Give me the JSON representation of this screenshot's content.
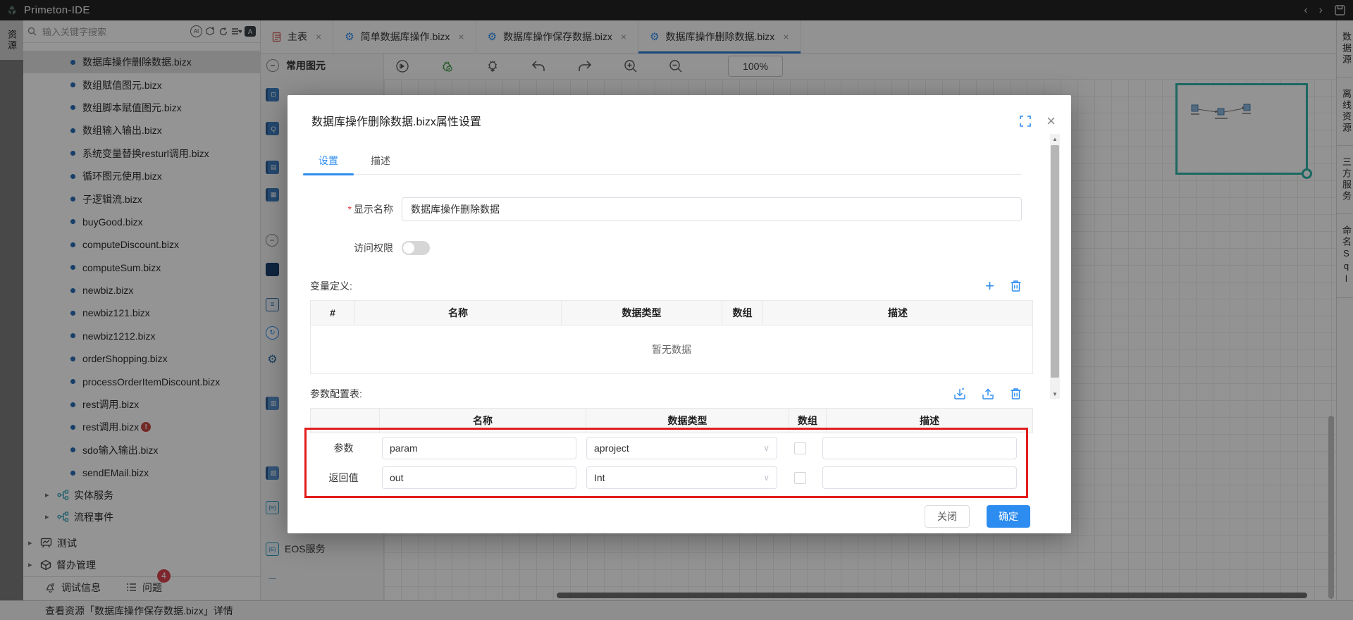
{
  "titlebar": {
    "title": "Primeton-IDE",
    "back": "‹",
    "forward": "›"
  },
  "left_rail": {
    "tab": "资源"
  },
  "sidebar": {
    "search": {
      "placeholder": "输入关键字搜索"
    },
    "files": [
      {
        "label": "数据库操作删除数据.bizx",
        "selected": true
      },
      {
        "label": "数组赋值图元.bizx"
      },
      {
        "label": "数组脚本赋值图元.bizx"
      },
      {
        "label": "数组输入输出.bizx"
      },
      {
        "label": "系统变量替换resturl调用.bizx"
      },
      {
        "label": "循环图元使用.bizx"
      },
      {
        "label": "子逻辑流.bizx"
      },
      {
        "label": "buyGood.bizx"
      },
      {
        "label": "computeDiscount.bizx"
      },
      {
        "label": "computeSum.bizx"
      },
      {
        "label": "newbiz.bizx"
      },
      {
        "label": "newbiz121.bizx"
      },
      {
        "label": "newbiz1212.bizx"
      },
      {
        "label": "orderShopping.bizx"
      },
      {
        "label": "processOrderItemDiscount.bizx"
      },
      {
        "label": "rest调用.bizx"
      },
      {
        "label": "rest调用.bizx",
        "badge": "!"
      },
      {
        "label": "sdo输入输出.bizx"
      },
      {
        "label": "sendEMail.bizx"
      }
    ],
    "services": [
      {
        "label": "实体服务"
      },
      {
        "label": "流程事件"
      }
    ],
    "sections": [
      {
        "label": "测试",
        "icon": "chart"
      },
      {
        "label": "督办管理",
        "icon": "cube"
      }
    ],
    "debug_bar": {
      "debug": "调试信息",
      "problems": "问题",
      "problems_badge": "4"
    }
  },
  "editor": {
    "tabs": [
      {
        "label": "主表",
        "icon": "doc"
      },
      {
        "label": "简单数据库操作.bizx",
        "icon": "gear"
      },
      {
        "label": "数据库操作保存数据.bizx",
        "icon": "gear"
      },
      {
        "label": "数据库操作删除数据.bizx",
        "icon": "gear",
        "active": true
      }
    ],
    "toolbar": {
      "zoom": "100%"
    }
  },
  "palette": {
    "group_title": "常用图元",
    "eos_label": "EOS服务"
  },
  "right_rail": {
    "items": [
      "数据源",
      "离线资源",
      "三方服务",
      "命名Sql"
    ]
  },
  "modal": {
    "title": "数据库操作删除数据.bizx属性设置",
    "tabs": [
      {
        "label": "设置",
        "active": true
      },
      {
        "label": "描述"
      }
    ],
    "fields": {
      "display_name_label": "显示名称",
      "display_name_value": "数据库操作删除数据",
      "access_label": "访问权限",
      "access_on": false
    },
    "variables": {
      "section_label": "变量定义:",
      "headers": [
        "#",
        "名称",
        "数据类型",
        "数组",
        "描述"
      ],
      "empty_text": "暂无数据"
    },
    "params": {
      "section_label": "参数配置表:",
      "headers": [
        "",
        "名称",
        "数据类型",
        "数组",
        "描述"
      ],
      "rows": [
        {
          "type": "参数",
          "name": "param",
          "datatype": "aproject",
          "array": false,
          "desc": ""
        },
        {
          "type": "返回值",
          "name": "out",
          "datatype": "Int",
          "array": false,
          "desc": ""
        }
      ]
    },
    "buttons": {
      "close": "关闭",
      "ok": "确定"
    }
  },
  "statusbar": {
    "text": "查看资源「数据库操作保存数据.bizx」详情"
  },
  "icons": {
    "close": "×",
    "tab_close": "×",
    "caret_down": "∨",
    "tree_caret": "▸",
    "plus": "+",
    "scroll_up": "▲",
    "scroll_down": "▼",
    "minus": "−",
    "gear": "⚙"
  },
  "colors": {
    "accent": "#2d8cf0",
    "teal": "#2fb3a8",
    "annotation": "#e21d1d",
    "badge": "#d9434e"
  }
}
